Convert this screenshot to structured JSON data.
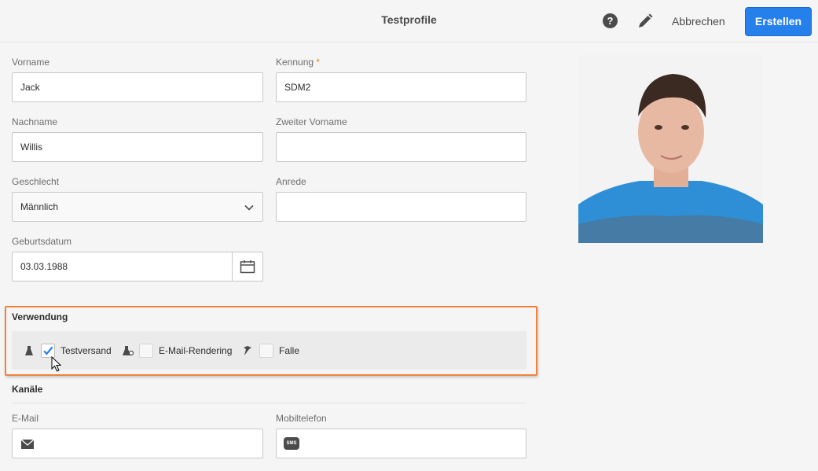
{
  "header": {
    "title": "Testprofile",
    "cancel_label": "Abbrechen",
    "create_label": "Erstellen",
    "help_glyph": "?"
  },
  "form": {
    "firstname": {
      "label": "Vorname",
      "value": "Jack"
    },
    "id": {
      "label": "Kennung",
      "required_mark": "*",
      "value": "SDM2"
    },
    "lastname": {
      "label": "Nachname",
      "value": "Willis"
    },
    "middlename": {
      "label": "Zweiter Vorname",
      "value": ""
    },
    "gender": {
      "label": "Geschlecht",
      "value": "Männlich"
    },
    "salutation": {
      "label": "Anrede",
      "value": ""
    },
    "birthdate": {
      "label": "Geburtsdatum",
      "value": "03.03.1988"
    }
  },
  "usage": {
    "title": "Verwendung",
    "options": [
      {
        "label": "Testversand",
        "checked": true,
        "icon": "flask-icon"
      },
      {
        "label": "E-Mail-Rendering",
        "checked": false,
        "icon": "flask-eye-icon"
      },
      {
        "label": "Falle",
        "checked": false,
        "icon": "trap-icon"
      }
    ]
  },
  "channels": {
    "title": "Kanäle",
    "email": {
      "label": "E-Mail",
      "value": "",
      "icon": "envelope-icon"
    },
    "mobile": {
      "label": "Mobiltelefon",
      "value": "",
      "icon": "sms-icon",
      "icon_text": "SMS"
    }
  },
  "colors": {
    "accent": "#2680eb",
    "highlight": "#f0833a",
    "required": "#e68619"
  }
}
